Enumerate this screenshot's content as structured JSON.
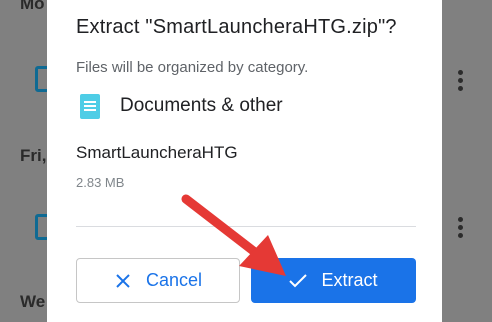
{
  "background": {
    "labels": [
      "Mo",
      "Fri,",
      "We"
    ],
    "accent_color": "#0f6a93"
  },
  "dialog": {
    "title": "Extract \"SmartLauncheraHTG.zip\"?",
    "subtitle": "Files will be organized by category.",
    "category": {
      "icon": "document-icon",
      "label": "Documents & other",
      "icon_color": "#4ecde6"
    },
    "file": {
      "name": "SmartLauncheraHTG",
      "size": "2.83 MB"
    },
    "buttons": {
      "cancel": {
        "label": "Cancel",
        "icon": "close-icon"
      },
      "extract": {
        "label": "Extract",
        "icon": "check-icon",
        "color": "#1a73e8"
      }
    }
  },
  "annotation": {
    "type": "red-arrow",
    "color": "#e53935",
    "points_to": "extract-button"
  }
}
